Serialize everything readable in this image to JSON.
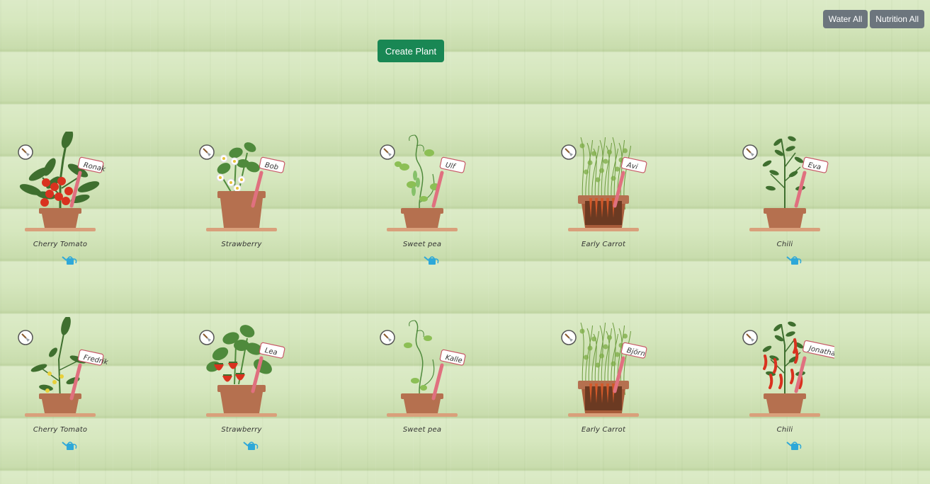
{
  "toolbar": {
    "water_all": "Water All",
    "nutrition_all": "Nutrition All"
  },
  "actions": {
    "create_plant": "Create Plant"
  },
  "colors": {
    "pot": "#b5704f",
    "shelf": "#d9a07b",
    "leaf": "#4f8a3c",
    "tag_border": "#c85a68",
    "create": "#198754",
    "gray_btn": "#6c757d"
  },
  "plants": [
    {
      "species": "Cherry Tomato",
      "owner": "Ronak",
      "type": "tomato",
      "watering_can": true
    },
    {
      "species": "Strawberry",
      "owner": "Bob",
      "type": "strawberry-flower",
      "watering_can": false
    },
    {
      "species": "Sweet pea",
      "owner": "Ulf",
      "type": "pea",
      "watering_can": true
    },
    {
      "species": "Early Carrot",
      "owner": "Avi",
      "type": "carrot",
      "watering_can": false
    },
    {
      "species": "Chili",
      "owner": "Eva",
      "type": "chili-small",
      "watering_can": true
    },
    {
      "species": "Cherry Tomato",
      "owner": "Fredrik",
      "type": "tomato-young",
      "watering_can": true
    },
    {
      "species": "Strawberry",
      "owner": "Lea",
      "type": "strawberry-fruit",
      "watering_can": true
    },
    {
      "species": "Sweet pea",
      "owner": "Kalle",
      "type": "pea-young",
      "watering_can": false
    },
    {
      "species": "Early Carrot",
      "owner": "Björn",
      "type": "carrot",
      "watering_can": false
    },
    {
      "species": "Chili",
      "owner": "Jonathan H",
      "type": "chili-fruit",
      "watering_can": true
    }
  ]
}
